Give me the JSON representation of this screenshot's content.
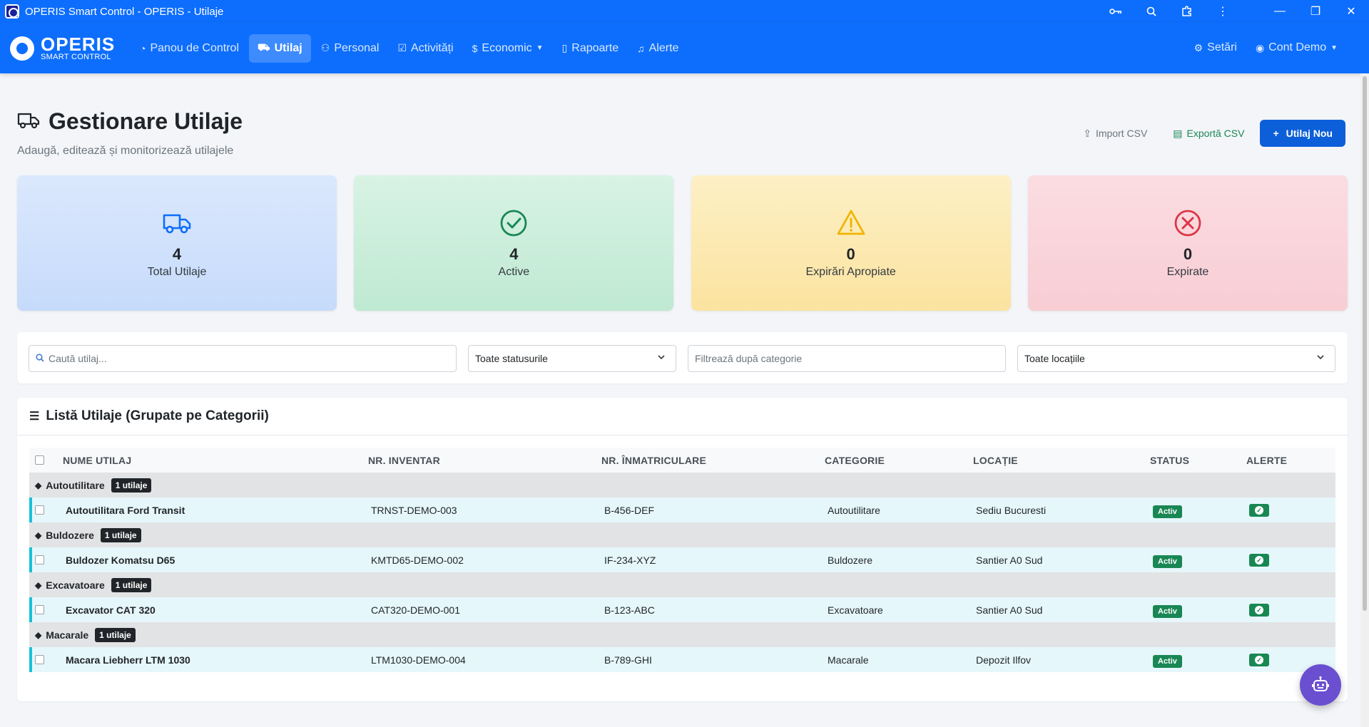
{
  "window": {
    "title": "OPERIS Smart Control - OPERIS - Utilaje",
    "controls": {
      "minimize": "—",
      "maximize": "❐",
      "close": "✕"
    }
  },
  "navbar": {
    "brand_name": "OPERIS",
    "brand_sub": "SMART CONTROL",
    "items": [
      {
        "label": "Panou de Control",
        "icon": "dashboard-icon"
      },
      {
        "label": "Utilaj",
        "icon": "truck-icon"
      },
      {
        "label": "Personal",
        "icon": "people-icon"
      },
      {
        "label": "Activități",
        "icon": "calendar-check-icon"
      },
      {
        "label": "Economic",
        "icon": "dollar-icon"
      },
      {
        "label": "Rapoarte",
        "icon": "document-icon"
      },
      {
        "label": "Alerte",
        "icon": "bell-icon"
      }
    ],
    "settings": "Setări",
    "account": "Cont Demo"
  },
  "header": {
    "title": "Gestionare Utilaje",
    "subtitle": "Adaugă, editează și monitorizează utilajele",
    "import_label": "Import CSV",
    "export_label": "Exportă CSV",
    "new_label": "Utilaj Nou"
  },
  "stats": [
    {
      "value": "4",
      "label": "Total Utilaje",
      "color": "#0d6efd"
    },
    {
      "value": "4",
      "label": "Active",
      "color": "#198754"
    },
    {
      "value": "0",
      "label": "Expirări Apropiate",
      "color": "#ffc107"
    },
    {
      "value": "0",
      "label": "Expirate",
      "color": "#dc3545"
    }
  ],
  "filters": {
    "search_placeholder": "Caută utilaj...",
    "status_value": "Toate statusurile",
    "category_placeholder": "Filtrează după categorie",
    "location_value": "Toate locațiile"
  },
  "table": {
    "title": "Listă Utilaje (Grupate pe Categorii)",
    "columns": [
      "Nume Utilaj",
      "Nr. Inventar",
      "Nr. Înmatriculare",
      "Categorie",
      "Locație",
      "Status",
      "Alerte"
    ],
    "groups": [
      {
        "name": "Autoutilitare",
        "count": "1 utilaje",
        "item": {
          "name": "Autoutilitara Ford Transit",
          "inventory": "TRNST-DEMO-003",
          "plate": "B-456-DEF",
          "category": "Autoutilitare",
          "location": "Sediu Bucuresti",
          "status": "Activ"
        }
      },
      {
        "name": "Buldozere",
        "count": "1 utilaje",
        "item": {
          "name": "Buldozer Komatsu D65",
          "inventory": "KMTD65-DEMO-002",
          "plate": "IF-234-XYZ",
          "category": "Buldozere",
          "location": "Santier A0 Sud",
          "status": "Activ"
        }
      },
      {
        "name": "Excavatoare",
        "count": "1 utilaje",
        "item": {
          "name": "Excavator CAT 320",
          "inventory": "CAT320-DEMO-001",
          "plate": "B-123-ABC",
          "category": "Excavatoare",
          "location": "Santier A0 Sud",
          "status": "Activ"
        }
      },
      {
        "name": "Macarale",
        "count": "1 utilaje",
        "item": {
          "name": "Macara Liebherr LTM 1030",
          "inventory": "LTM1030-DEMO-004",
          "plate": "B-789-GHI",
          "category": "Macarale",
          "location": "Depozit Ilfov",
          "status": "Activ"
        }
      }
    ]
  },
  "colors": {
    "primary": "#0d6efd",
    "success": "#198754",
    "warning": "#ffc107",
    "danger": "#dc3545",
    "accent_row": "#17c1d6"
  }
}
